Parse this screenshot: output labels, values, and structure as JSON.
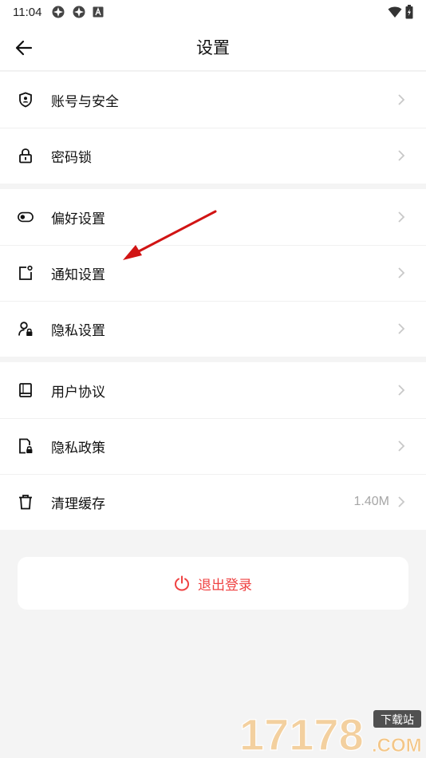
{
  "status_bar": {
    "time": "11:04"
  },
  "header": {
    "title": "设置"
  },
  "groups": [
    {
      "items": [
        {
          "label": "账号与安全",
          "icon": "shield-user-icon"
        },
        {
          "label": "密码锁",
          "icon": "lock-icon"
        }
      ]
    },
    {
      "items": [
        {
          "label": "偏好设置",
          "icon": "toggle-icon"
        },
        {
          "label": "通知设置",
          "icon": "notification-icon"
        },
        {
          "label": "隐私设置",
          "icon": "privacy-user-icon"
        }
      ]
    },
    {
      "items": [
        {
          "label": "用户协议",
          "icon": "book-icon"
        },
        {
          "label": "隐私政策",
          "icon": "document-lock-icon"
        },
        {
          "label": "清理缓存",
          "icon": "trash-icon",
          "value": "1.40M"
        }
      ]
    }
  ],
  "logout": {
    "label": "退出登录",
    "icon": "power-icon"
  },
  "watermark": {
    "number": "17178",
    "tag": "下载站",
    "domain": ".COM"
  },
  "colors": {
    "accent_red": "#ef4242",
    "background": "#f4f4f4"
  }
}
